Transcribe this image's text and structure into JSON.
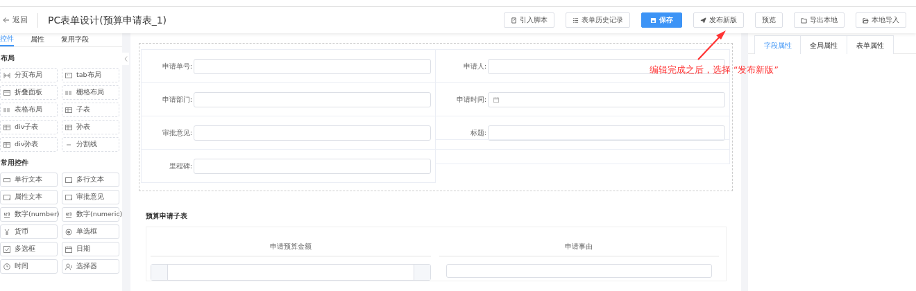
{
  "header": {
    "back": "返回",
    "title": "PC表单设计(预算申请表_1)",
    "buttons": [
      {
        "label": "引入脚本",
        "kind": "script",
        "primary": false
      },
      {
        "label": "表单历史记录",
        "kind": "history",
        "primary": false
      },
      {
        "label": "保存",
        "kind": "save",
        "primary": true
      },
      {
        "label": "发布新版",
        "kind": "send",
        "primary": false
      },
      {
        "label": "预览",
        "kind": "none",
        "primary": false
      },
      {
        "label": "导出本地",
        "kind": "folder",
        "primary": false
      },
      {
        "label": "本地导入",
        "kind": "folder-open",
        "primary": false
      }
    ]
  },
  "left_tabs": [
    {
      "label": "控件",
      "selected": true
    },
    {
      "label": "属性",
      "selected": false
    },
    {
      "label": "复用字段",
      "selected": false
    }
  ],
  "palette": [
    {
      "title": "布局",
      "dashed": true,
      "items": [
        {
          "label": "分页布局",
          "kind": "pages"
        },
        {
          "label": "tab布局",
          "kind": "tab"
        },
        {
          "label": "折叠面板",
          "kind": "panel"
        },
        {
          "label": "栅格布局",
          "kind": "list"
        },
        {
          "label": "表格布局",
          "kind": "list"
        },
        {
          "label": "子表",
          "kind": "table"
        },
        {
          "label": "div子表",
          "kind": "table"
        },
        {
          "label": "孙表",
          "kind": "table"
        },
        {
          "label": "div孙表",
          "kind": "table"
        },
        {
          "label": "分割线",
          "kind": "line"
        }
      ]
    },
    {
      "title": "常用控件",
      "dashed": false,
      "items": [
        {
          "label": "单行文本",
          "kind": "input"
        },
        {
          "label": "多行文本",
          "kind": "textarea"
        },
        {
          "label": "属性文本",
          "kind": "textarea"
        },
        {
          "label": "审批意见",
          "kind": "textarea"
        },
        {
          "label": "数字(number)",
          "kind": "number"
        },
        {
          "label": "数字(numeric)",
          "kind": "number"
        },
        {
          "label": "货币",
          "kind": "currency"
        },
        {
          "label": "单选框",
          "kind": "radio"
        },
        {
          "label": "多选框",
          "kind": "checkbox"
        },
        {
          "label": "日期",
          "kind": "date"
        },
        {
          "label": "时间",
          "kind": "clock"
        },
        {
          "label": "选择器",
          "kind": "user"
        }
      ]
    }
  ],
  "form": {
    "fields": [
      {
        "label": "申请单号:",
        "kind": "text"
      },
      {
        "label": "申请人:",
        "kind": "text"
      },
      {
        "label": "申请部门:",
        "kind": "text"
      },
      {
        "label": "申请时间:",
        "kind": "date"
      },
      {
        "label": "审批意见:",
        "kind": "text"
      },
      {
        "label": "标题:",
        "kind": "text"
      },
      {
        "label": "里程碑:",
        "kind": "text"
      },
      {
        "kind": "empty"
      }
    ]
  },
  "subtable": {
    "title": "预算申请子表",
    "columns": [
      {
        "header": "申请预算金额",
        "kind": "number"
      },
      {
        "header": "申请事由",
        "kind": "text"
      }
    ]
  },
  "right_tabs": [
    {
      "label": "字段属性",
      "selected": true
    },
    {
      "label": "全局属性",
      "selected": false
    },
    {
      "label": "表单属性",
      "selected": false
    }
  ],
  "annotation": {
    "text": "编辑完成之后，选择 “发布新版”"
  }
}
